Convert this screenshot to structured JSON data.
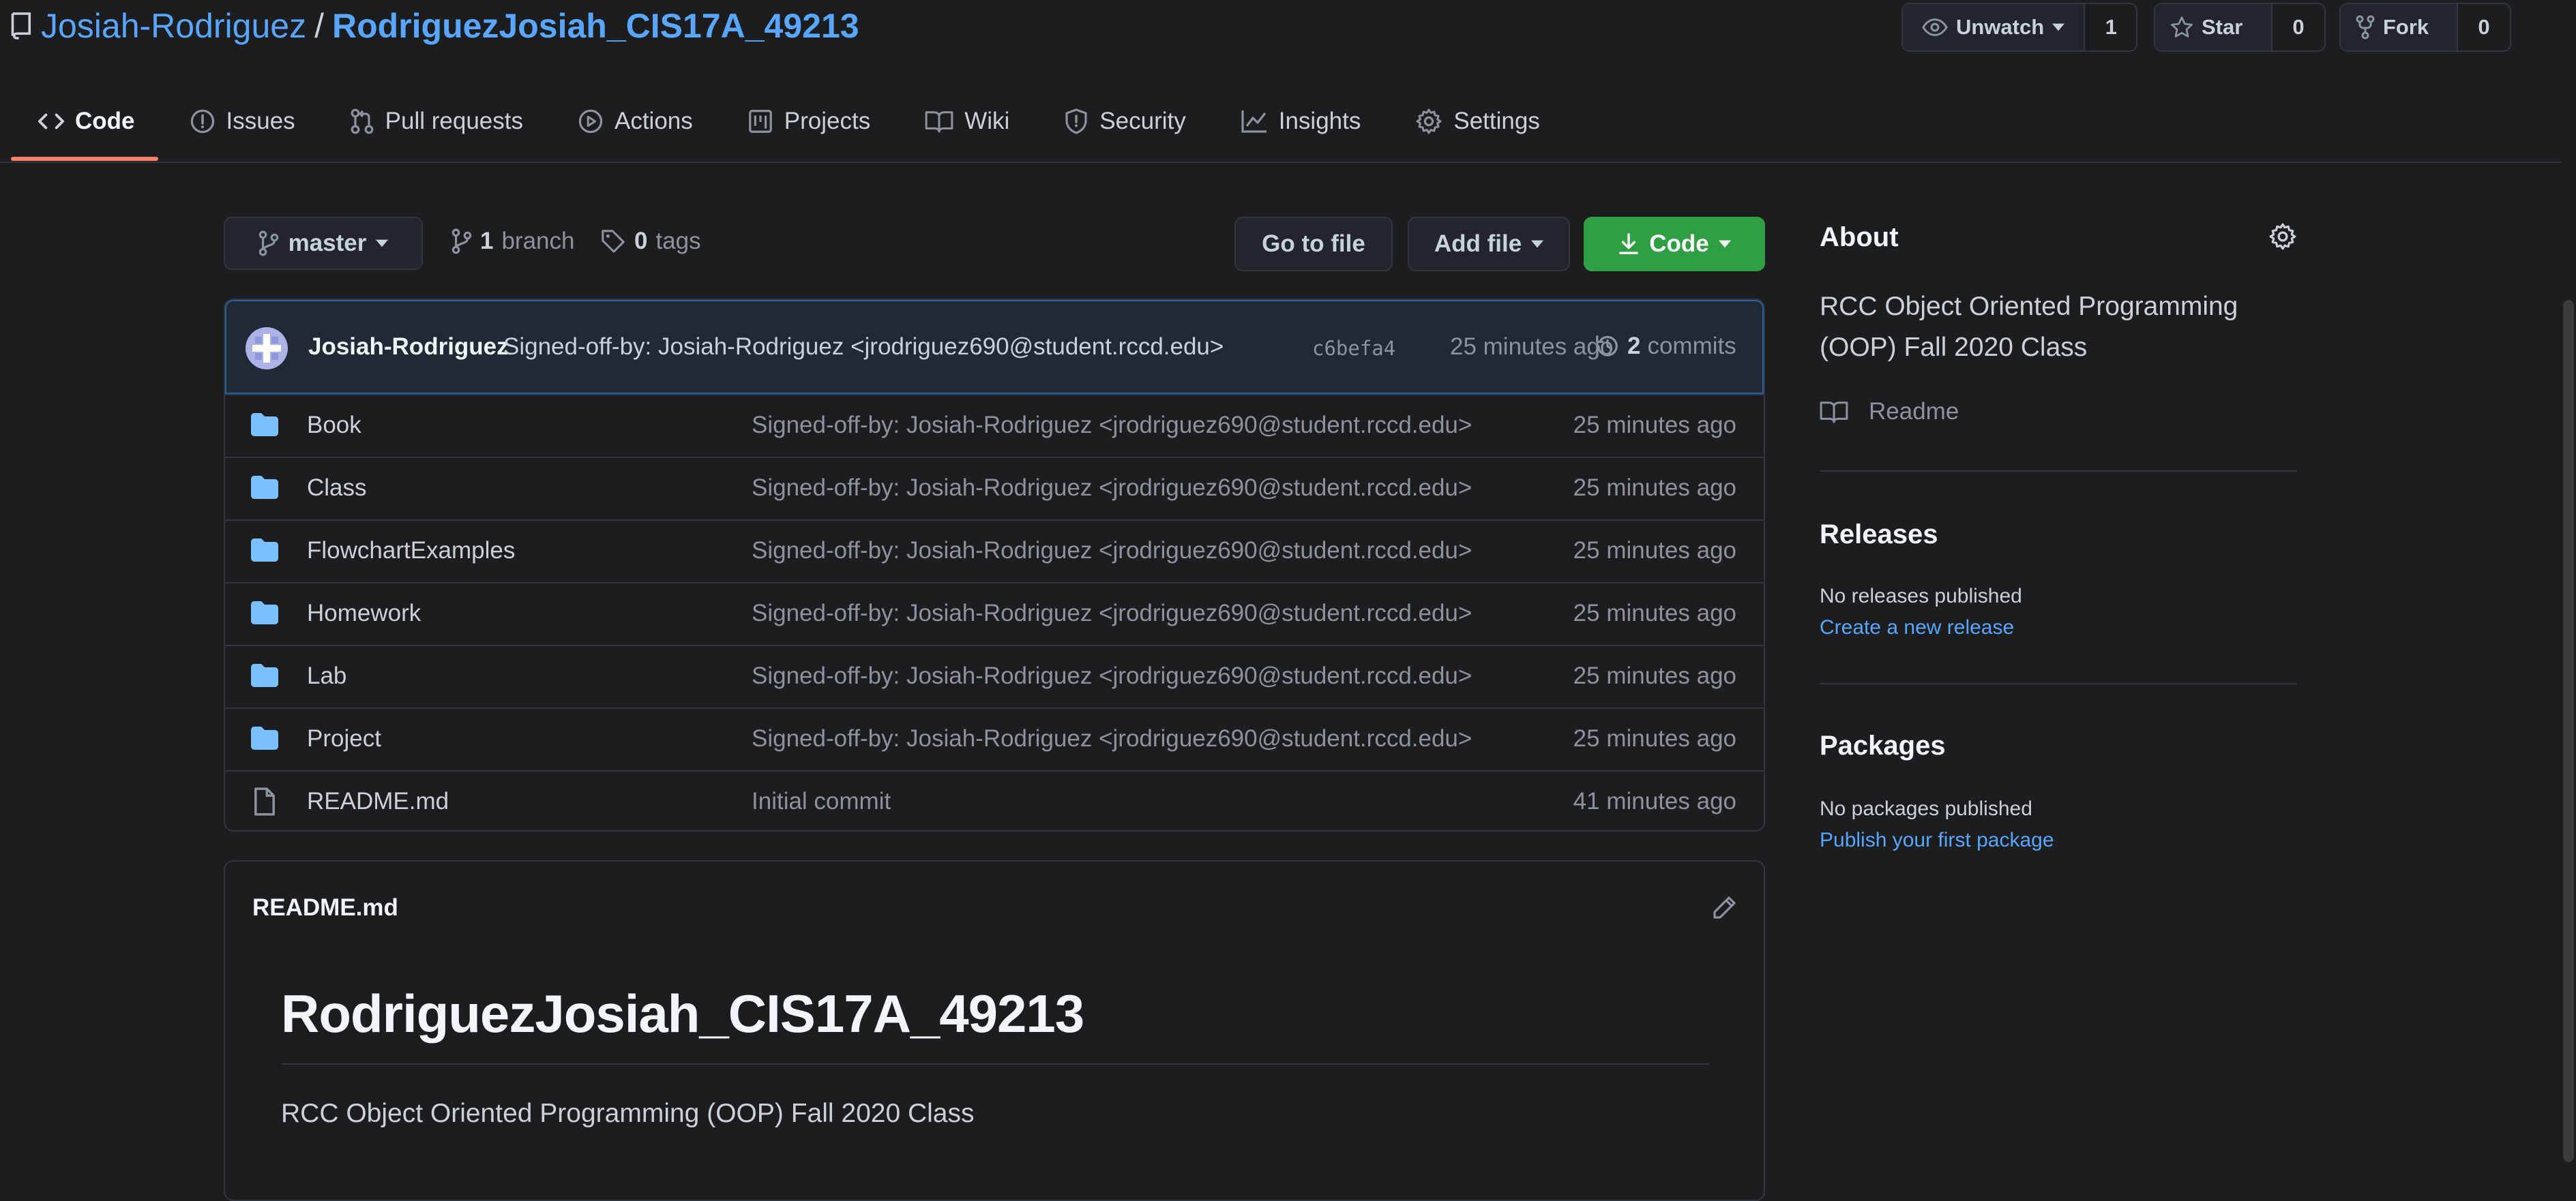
{
  "repo": {
    "owner": "Josiah-Rodriguez",
    "separator": "/",
    "name": "RodriguezJosiah_CIS17A_49213"
  },
  "header_actions": {
    "watch_label": "Unwatch",
    "watch_count": "1",
    "star_label": "Star",
    "star_count": "0",
    "fork_label": "Fork",
    "fork_count": "0"
  },
  "nav": {
    "tabs": [
      {
        "label": "Code",
        "icon": "code-icon"
      },
      {
        "label": "Issues",
        "icon": "issue-icon"
      },
      {
        "label": "Pull requests",
        "icon": "pull-request-icon"
      },
      {
        "label": "Actions",
        "icon": "play-icon"
      },
      {
        "label": "Projects",
        "icon": "project-icon"
      },
      {
        "label": "Wiki",
        "icon": "book-icon"
      },
      {
        "label": "Security",
        "icon": "shield-icon"
      },
      {
        "label": "Insights",
        "icon": "graph-icon"
      },
      {
        "label": "Settings",
        "icon": "gear-icon"
      }
    ],
    "active": "Code"
  },
  "branch_bar": {
    "branch_name": "master",
    "branch_count": "1",
    "branch_word": "branch",
    "tag_count": "0",
    "tag_word": "tags",
    "go_to_file": "Go to file",
    "add_file": "Add file",
    "code": "Code"
  },
  "latest_commit": {
    "author": "Josiah-Rodriguez",
    "message": "Signed-off-by: Josiah-Rodriguez <jrodriguez690@student.rccd.edu>",
    "sha": "c6befa4",
    "age": "25 minutes ago",
    "commit_count": "2",
    "commit_word": "commits"
  },
  "files": [
    {
      "name": "Book",
      "type": "dir",
      "message": "Signed-off-by: Josiah-Rodriguez <jrodriguez690@student.rccd.edu>",
      "age": "25 minutes ago"
    },
    {
      "name": "Class",
      "type": "dir",
      "message": "Signed-off-by: Josiah-Rodriguez <jrodriguez690@student.rccd.edu>",
      "age": "25 minutes ago"
    },
    {
      "name": "FlowchartExamples",
      "type": "dir",
      "message": "Signed-off-by: Josiah-Rodriguez <jrodriguez690@student.rccd.edu>",
      "age": "25 minutes ago"
    },
    {
      "name": "Homework",
      "type": "dir",
      "message": "Signed-off-by: Josiah-Rodriguez <jrodriguez690@student.rccd.edu>",
      "age": "25 minutes ago"
    },
    {
      "name": "Lab",
      "type": "dir",
      "message": "Signed-off-by: Josiah-Rodriguez <jrodriguez690@student.rccd.edu>",
      "age": "25 minutes ago"
    },
    {
      "name": "Project",
      "type": "dir",
      "message": "Signed-off-by: Josiah-Rodriguez <jrodriguez690@student.rccd.edu>",
      "age": "25 minutes ago"
    },
    {
      "name": "README.md",
      "type": "file",
      "message": "Initial commit",
      "age": "41 minutes ago"
    }
  ],
  "readme": {
    "filename": "README.md",
    "heading": "RodriguezJosiah_CIS17A_49213",
    "body": "RCC Object Oriented Programming (OOP) Fall 2020 Class"
  },
  "about": {
    "title": "About",
    "description": "RCC Object Oriented Programming (OOP) Fall 2020 Class",
    "readme_link": "Readme"
  },
  "releases": {
    "title": "Releases",
    "status": "No releases published",
    "link": "Create a new release"
  },
  "packages": {
    "title": "Packages",
    "status": "No packages published",
    "link": "Publish your first package"
  },
  "colors": {
    "background": "#1c1d1f",
    "link": "#58a6ff",
    "folder": "#79c0ff",
    "active_tab": "#f78166",
    "code_button": "#2ea043"
  }
}
